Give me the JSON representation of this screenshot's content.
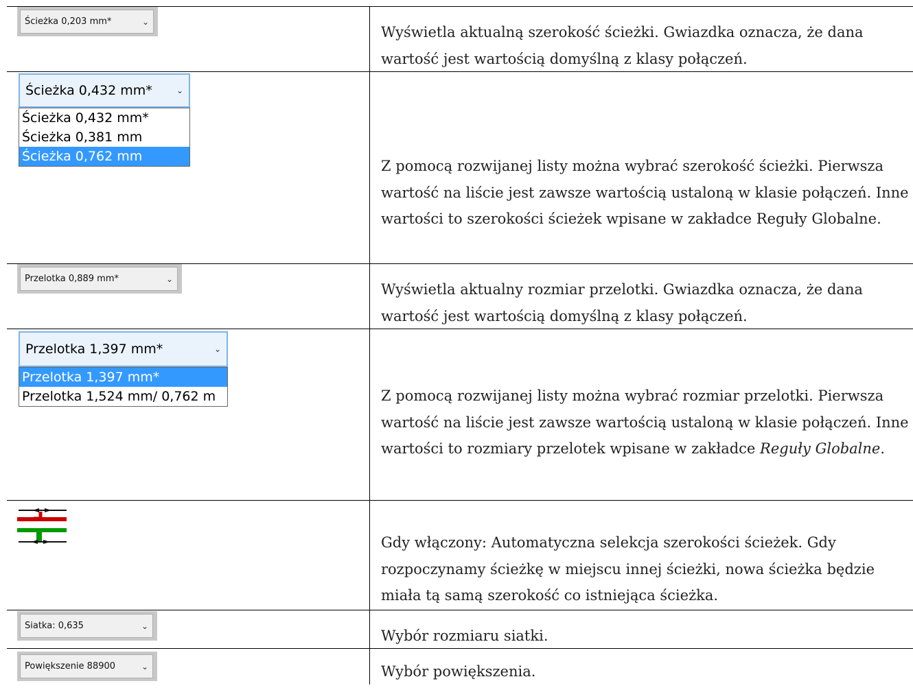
{
  "rows": [
    {
      "control": {
        "label": "Ścieżka 0,203 mm*"
      },
      "description": "Wyświetla aktualną szerokość ścieżki. Gwiazdka oznacza, że dana wartość jest wartością domyślną z klasy połączeń."
    },
    {
      "control": {
        "label": "Ścieżka 0,432 mm*",
        "options": [
          "Ścieżka 0,432 mm*",
          "Ścieżka 0,381 mm",
          "Ścieżka 0,762 mm"
        ],
        "selected_index": 2
      },
      "description": "Z pomocą rozwijanej listy można wybrać szerokość ścieżki. Pierwsza wartość na liście jest zawsze wartością ustaloną w klasie połączeń. Inne wartości to szerokości ścieżek wpisane w zakładce Reguły Globalne."
    },
    {
      "control": {
        "label": "Przelotka 0,889 mm*"
      },
      "description": "Wyświetla aktualny rozmiar przelotki. Gwiazdka oznacza, że dana wartość jest wartością domyślną z klasy połączeń."
    },
    {
      "control": {
        "label": "Przelotka 1,397 mm*",
        "options": [
          "Przelotka 1,397 mm*",
          "Przelotka 1,524 mm/ 0,762 m"
        ],
        "selected_index": 0
      },
      "description_pre": "Z pomocą rozwijanej listy można wybrać rozmiar przelotki. Pierwsza wartość na liście jest zawsze wartością ustaloną w klasie połączeń. Inne wartości to rozmiary przelotek wpisane w zakładce ",
      "description_em": "Reguły Globalne",
      "description_post": "."
    },
    {
      "control": {
        "icon": "auto-track-width-icon",
        "colors": {
          "top": "#cc0000",
          "bottom": "#009900"
        }
      },
      "description": "Gdy włączony: Automatyczna selekcja szerokości ścieżek. Gdy rozpoczynamy ścieżkę w miejscu innej ścieżki, nowa ścieżka będzie miała tą samą szerokość co istniejąca ścieżka."
    },
    {
      "control": {
        "label": "Siatka: 0,635"
      },
      "description": "Wybór rozmiaru siatki."
    },
    {
      "control": {
        "label": "Powiększenie 88900"
      },
      "description": "Wybór powiększenia."
    }
  ]
}
